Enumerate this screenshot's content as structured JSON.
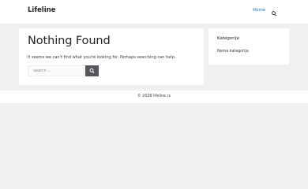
{
  "header": {
    "site_title": "Lifeline",
    "nav": {
      "home_label": "Home"
    }
  },
  "main": {
    "title": "Nothing Found",
    "message": "It seems we can't find what you're looking for. Perhaps searching can help.",
    "search": {
      "placeholder": "Search ...",
      "value": ""
    }
  },
  "sidebar": {
    "widget_title": "Kategorije",
    "items": [
      "Nema kategorija"
    ]
  },
  "footer": {
    "copyright": "© 2026 lifeline.rs"
  },
  "colors": {
    "link": "#1e73be",
    "search_button": "#55555e",
    "background": "#f0f0f1"
  }
}
